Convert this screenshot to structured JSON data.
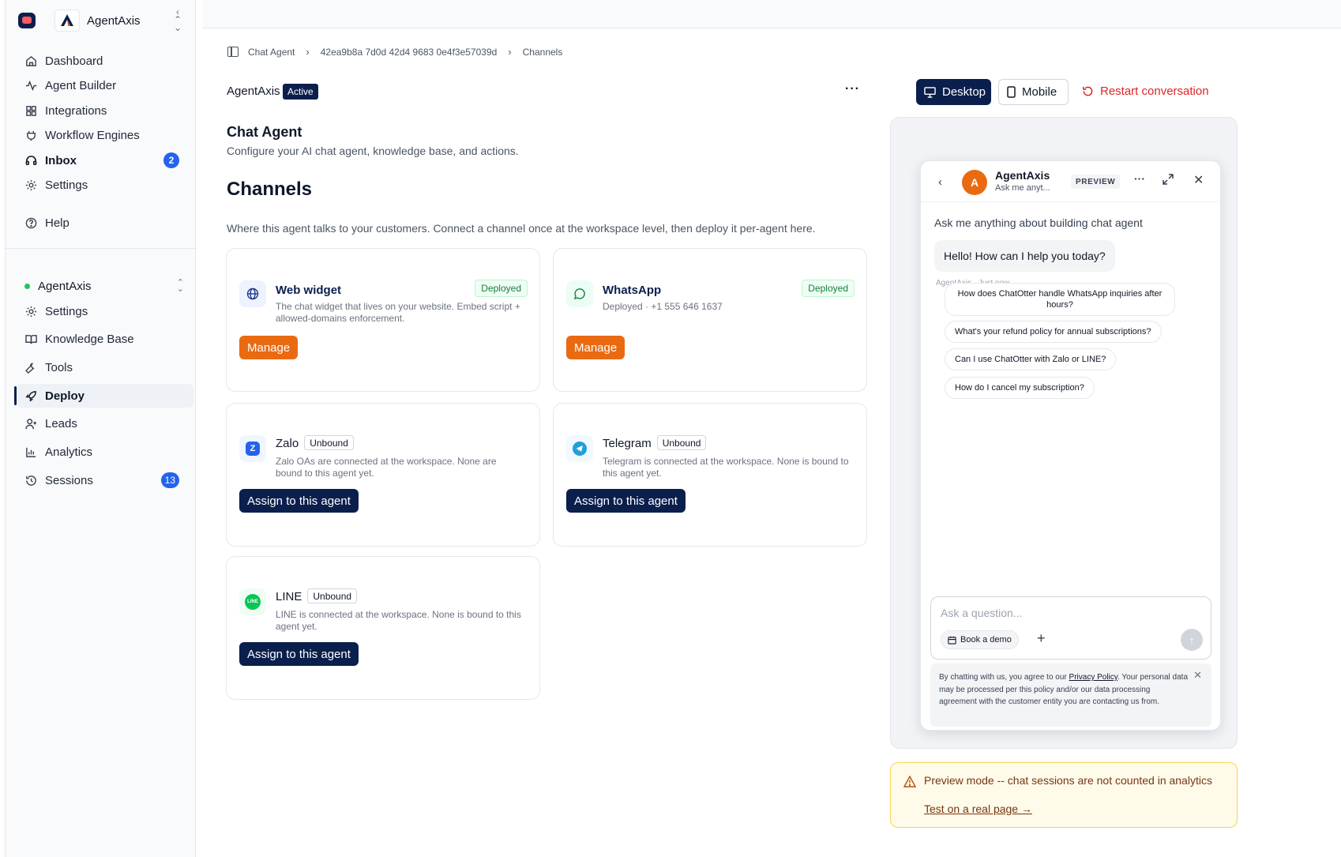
{
  "sidebar": {
    "brand": "AgentAxis",
    "nav": [
      {
        "label": "Dashboard",
        "icon": "home-icon"
      },
      {
        "label": "Agent Builder",
        "icon": "activity-icon"
      },
      {
        "label": "Integrations",
        "icon": "grid-icon"
      },
      {
        "label": "Workflow Engines",
        "icon": "plug-icon"
      },
      {
        "label": "Inbox",
        "icon": "headset-icon",
        "badge": "2"
      },
      {
        "label": "Settings",
        "icon": "gear-icon"
      },
      {
        "label": "Help",
        "icon": "help-icon"
      }
    ],
    "workspace": "AgentAxis",
    "agent_nav": [
      {
        "label": "Settings",
        "icon": "gear-icon"
      },
      {
        "label": "Knowledge Base",
        "icon": "book-icon"
      },
      {
        "label": "Tools",
        "icon": "wrench-icon"
      },
      {
        "label": "Deploy",
        "icon": "rocket-icon",
        "active": true
      },
      {
        "label": "Leads",
        "icon": "user-plus-icon"
      },
      {
        "label": "Analytics",
        "icon": "chart-icon"
      },
      {
        "label": "Sessions",
        "icon": "history-icon",
        "badge": "13"
      }
    ]
  },
  "breadcrumb": [
    "Chat Agent",
    "42ea9b8a 7d0d 42d4 9683 0e4f3e57039d",
    "Channels"
  ],
  "header": {
    "agent_name": "AgentAxis",
    "status": "Active",
    "more": "···"
  },
  "page": {
    "title": "Chat Agent",
    "subtitle": "Configure your AI chat agent, knowledge base, and actions.",
    "section_title": "Channels",
    "section_subtitle": "Where this agent talks to your customers. Connect a channel once at the workspace level, then deploy it per-agent here."
  },
  "channels": [
    {
      "name": "Web widget",
      "status": "Deployed",
      "desc": "The chat widget that lives on your website. Embed script + allowed-domains enforcement.",
      "button": "Manage",
      "icon": "globe-icon"
    },
    {
      "name": "WhatsApp",
      "status": "Deployed",
      "desc": "Deployed · +1 555 646 1637",
      "button": "Manage",
      "icon": "whatsapp-icon"
    },
    {
      "name": "Zalo",
      "status": "Unbound",
      "desc": "Zalo OAs are connected at the workspace. None are bound to this agent yet.",
      "button": "Assign to this agent",
      "icon": "zalo-icon"
    },
    {
      "name": "Telegram",
      "status": "Unbound",
      "desc": "Telegram is connected at the workspace. None is bound to this agent yet.",
      "button": "Assign to this agent",
      "icon": "telegram-icon"
    },
    {
      "name": "LINE",
      "status": "Unbound",
      "desc": "LINE is connected at the workspace. None is bound to this agent yet.",
      "button": "Assign to this agent",
      "icon": "line-icon"
    }
  ],
  "preview": {
    "desktop": "Desktop",
    "mobile": "Mobile",
    "restart": "Restart conversation",
    "widget": {
      "avatar": "A",
      "title": "AgentAxis",
      "subtitle": "Ask me anyt...",
      "badge": "PREVIEW",
      "intro": "Ask me anything about building chat agent",
      "greeting": "Hello! How can I help you today?",
      "meta": "AgentAxis · Just now",
      "suggestions": [
        "How does ChatOtter handle WhatsApp inquiries after hours?",
        "What's your refund policy for annual subscriptions?",
        "Can I use ChatOtter with Zalo or LINE?",
        "How do I cancel my subscription?"
      ],
      "input_placeholder": "Ask a question...",
      "book_demo": "Book a demo",
      "consent_pre": "By chatting with us, you agree to our ",
      "consent_link": "Privacy Policy",
      "consent_post": ". Your personal data may be processed per this policy and/or our data processing agreement with the customer entity you are contacting us from."
    },
    "notice": "Preview mode -- chat sessions are not counted in analytics",
    "notice_link": "Test on a real page →"
  },
  "colors": {
    "navy": "#0b1f4d",
    "orange": "#ea6a12",
    "badge_blue": "#2563eb",
    "danger": "#dc2626",
    "success": "#15803d"
  }
}
